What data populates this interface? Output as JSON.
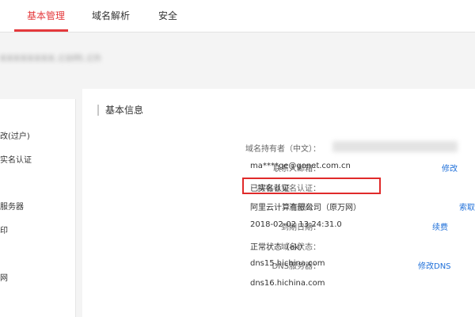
{
  "tabs": [
    {
      "label": "基本管理",
      "active": true
    },
    {
      "label": "域名解析",
      "active": false
    },
    {
      "label": "安全",
      "active": false
    }
  ],
  "domain_title": "xxxxxxxx.com.cn",
  "sidebar": {
    "items": [
      {
        "label": "改(过户)"
      },
      {
        "label": "实名认证"
      },
      {
        "label": "服务器"
      },
      {
        "label": "印"
      },
      {
        "label": "网"
      }
    ]
  },
  "section": {
    "title": "基本信息"
  },
  "info": {
    "owner_label": "域名持有者（中文）：",
    "email_label": "联系人邮箱：",
    "email_value": "ma****ge@gonet.com.cn",
    "email_link": "修改",
    "verify_label": "持有者实名认证：",
    "verify_value": "已实名认证",
    "registrar_label": "注册商：",
    "registrar_value": "阿里云计算有限公司（原万网）",
    "registrar_link": "索取",
    "expiry_label": "到期日期：",
    "expiry_value": "2018-02-02 13:24:31.0",
    "expiry_link": "续费",
    "status_label": "域名状态：",
    "status_value": "正常状态（ok）",
    "dns_label": "DNS服务器：",
    "dns1": "dns15.hichina.com",
    "dns_link": "修改DNS",
    "dns2": "dns16.hichina.com"
  },
  "colors": {
    "accent": "#e4393c",
    "link": "#1e6fd9",
    "highlight": "#e02a2a"
  }
}
